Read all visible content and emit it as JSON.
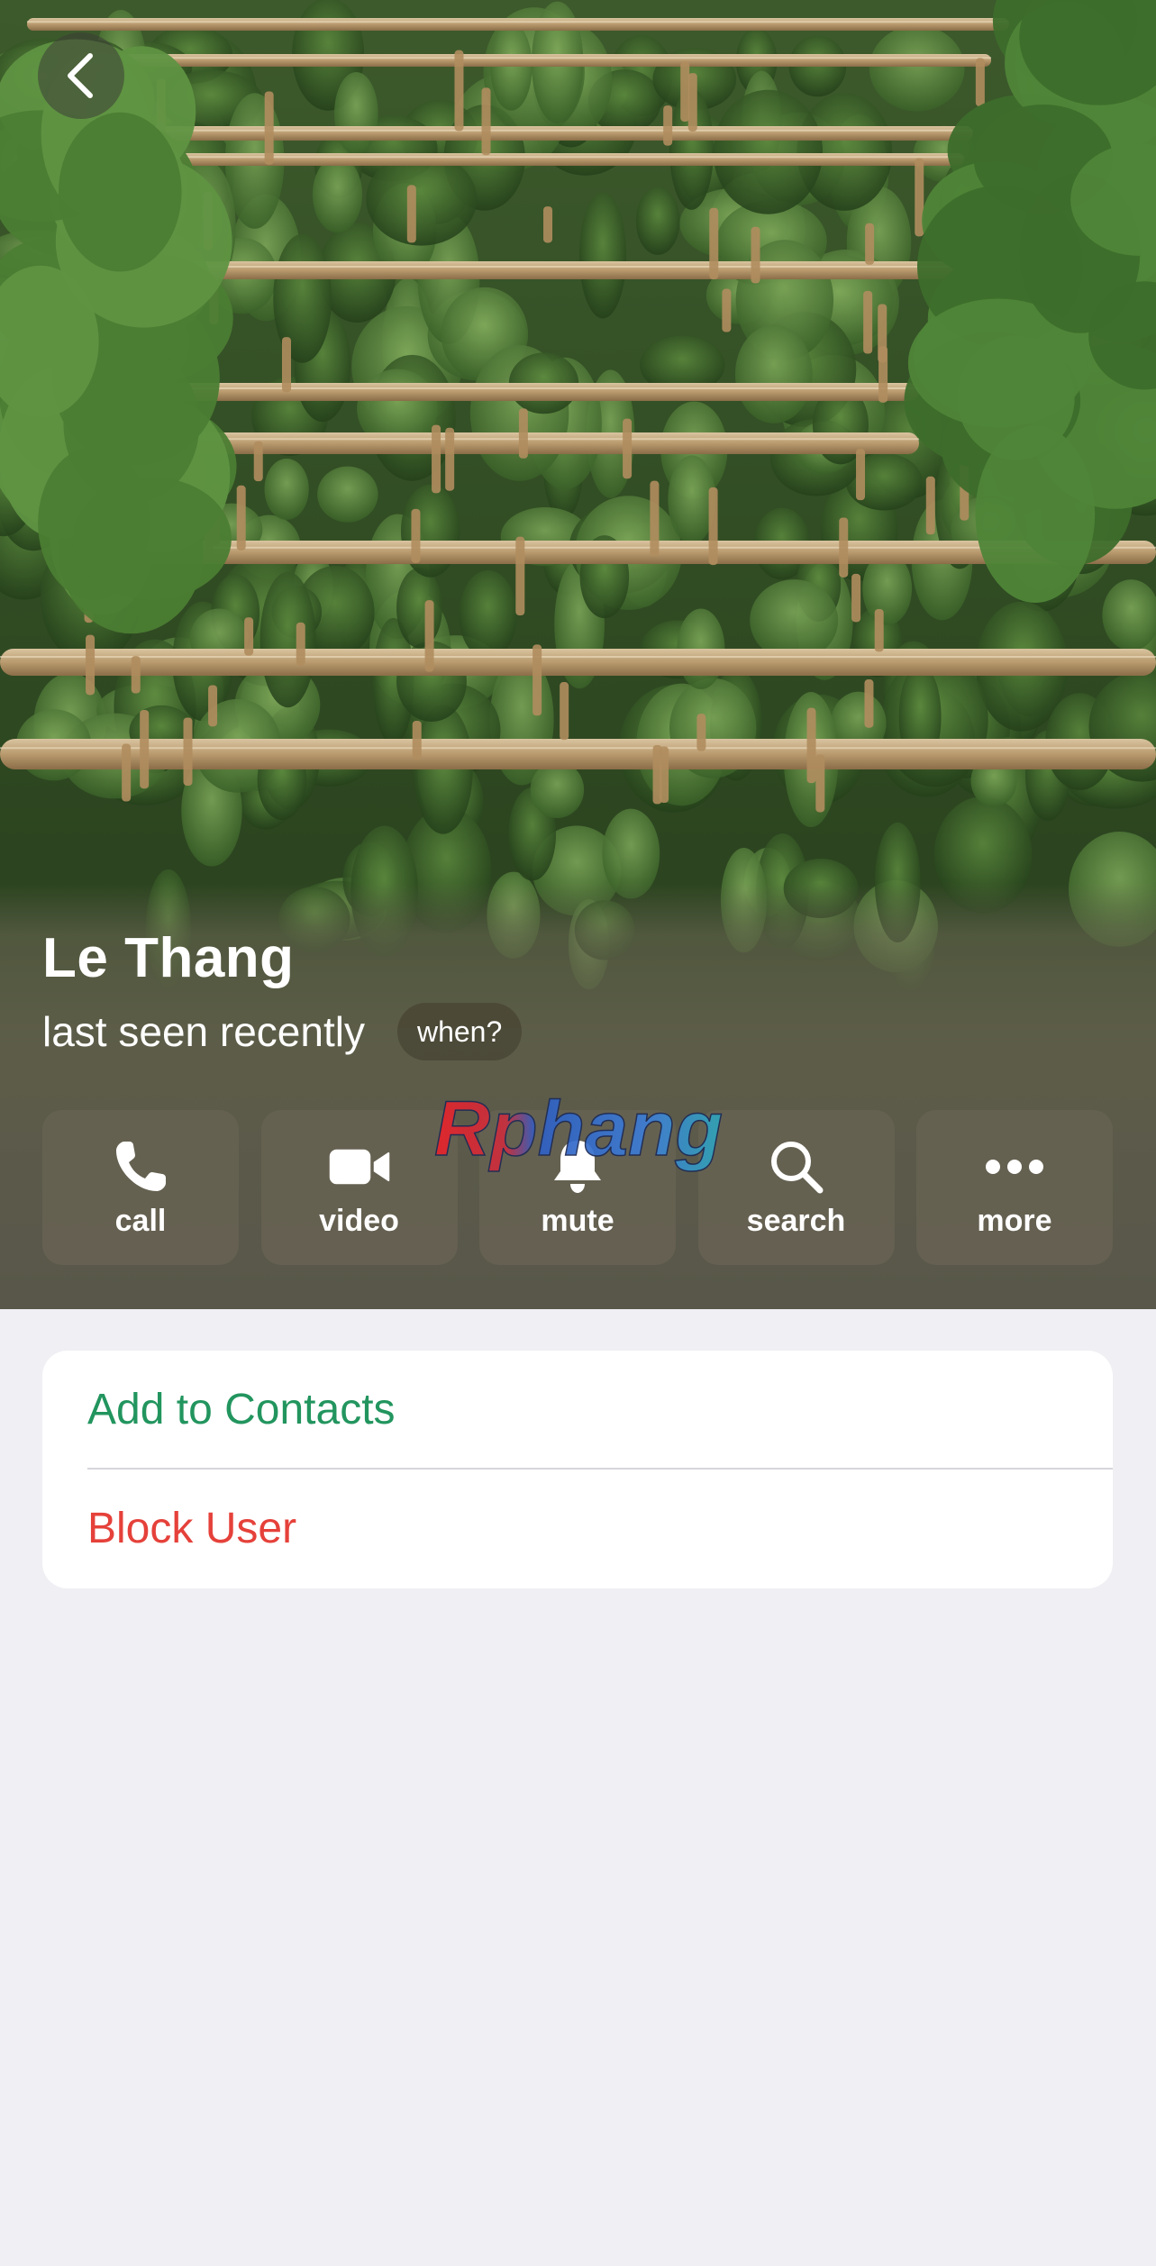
{
  "profile": {
    "name": "Le Thang",
    "status": "last seen recently",
    "when_label": "when?"
  },
  "actions": [
    {
      "label": "call",
      "icon": "phone-icon"
    },
    {
      "label": "video",
      "icon": "video-camera-icon"
    },
    {
      "label": "mute",
      "icon": "bell-icon"
    },
    {
      "label": "search",
      "icon": "magnifier-icon"
    },
    {
      "label": "more",
      "icon": "ellipsis-icon"
    }
  ],
  "watermark": {
    "text": "Rphang"
  },
  "menu": {
    "add_contact": "Add to Contacts",
    "block_user": "Block User"
  },
  "colors": {
    "add_contact": "#22955e",
    "block_user": "#e5413a",
    "background": "#efeff4"
  }
}
